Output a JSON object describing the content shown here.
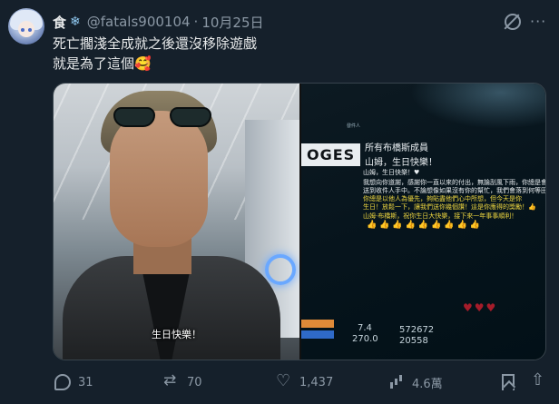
{
  "post": {
    "display_name": "食",
    "name_emoji": "❄",
    "handle": "@fatals900104",
    "separator": "·",
    "date": "10月25日",
    "text_line1": "死亡擱淺全成就之後還沒移除遊戲",
    "text_line2": "就是為了這個🥰"
  },
  "media": {
    "left_subtitle": "生日快樂！",
    "right": {
      "logo_text": "OGES",
      "header_tiny": "發件人",
      "title": "所有布橋斯成員",
      "subtitle": "山姆，生日快樂！",
      "lines": [
        {
          "text": "山姆，生日快樂！♥",
          "color": "white"
        },
        {
          "text": "我想向你道謝，感謝你一直以來的付出，無論刮風下雨，你總是會把",
          "color": "white"
        },
        {
          "text": "送到收件人手中。不論想像如果沒有你的幫忙，我們會落到何等田地",
          "color": "white"
        },
        {
          "text": "你總是以他人為優先，夠貼盡他們心中所想，但今天是你",
          "color": "yellow"
        },
        {
          "text": "生日！放鬆一下，讓我們送你幾個讚！這是你應得的獎勵！👍",
          "color": "yellow"
        },
        {
          "text": "山姆·布橋斯，祝你生日大快樂，接下來一年事事順利！",
          "color": "yellow"
        }
      ],
      "emoji_row": "👍👍👍👍👍👍👍👍👍",
      "stat1": "7.4",
      "stat2": "572672",
      "stat3": "270.0",
      "stat4": "20558"
    }
  },
  "actions": {
    "replies": "31",
    "reposts": "70",
    "likes": "1,437",
    "views": "4.6萬"
  },
  "icons": {
    "grok": "grok-icon",
    "more": "more-icon",
    "reply": "reply-icon",
    "retweet": "retweet-icon",
    "like": "heart-icon",
    "views": "views-icon",
    "bookmark": "bookmark-icon",
    "share": "share-icon"
  }
}
